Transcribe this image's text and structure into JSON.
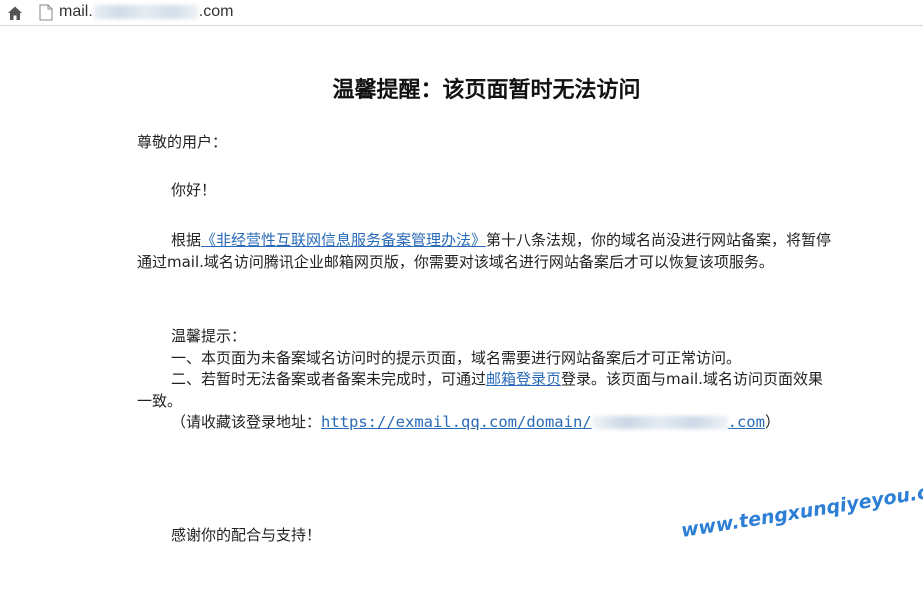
{
  "browser": {
    "url_prefix": "mail.",
    "url_suffix": ".com"
  },
  "page": {
    "title": "温馨提醒：该页面暂时无法访问",
    "salutation": "尊敬的用户：",
    "greeting": "你好！",
    "para1_before_link": "根据",
    "para1_link": "《非经营性互联网信息服务备案管理办法》",
    "para1_after_link": "第十八条法规，你的域名尚没进行网站备案，将暂停通过mail.域名访问腾讯企业邮箱网页版，你需要对该域名进行网站备案后才可以恢复该项服务。",
    "tips_heading": "温馨提示：",
    "tip1": "一、本页面为未备案域名访问时的提示页面，域名需要进行网站备案后才可正常访问。",
    "tip2_before_link": "二、若暂时无法备案或者备案未完成时，可通过",
    "tip2_link": "邮箱登录页",
    "tip2_after_link": "登录。该页面与mail.域名访问页面效果一致。",
    "bookmark_prefix": "（请收藏该登录地址：",
    "bookmark_url_prefix": "https://exmail.qq.com/domain/",
    "bookmark_url_suffix": ".com",
    "bookmark_suffix": "）",
    "thanks": "感谢你的配合与支持！"
  },
  "watermark": "www.tengxunqiyeyou.com",
  "colors": {
    "link": "#2a6bb8",
    "watermark": "#2d7fd6"
  }
}
